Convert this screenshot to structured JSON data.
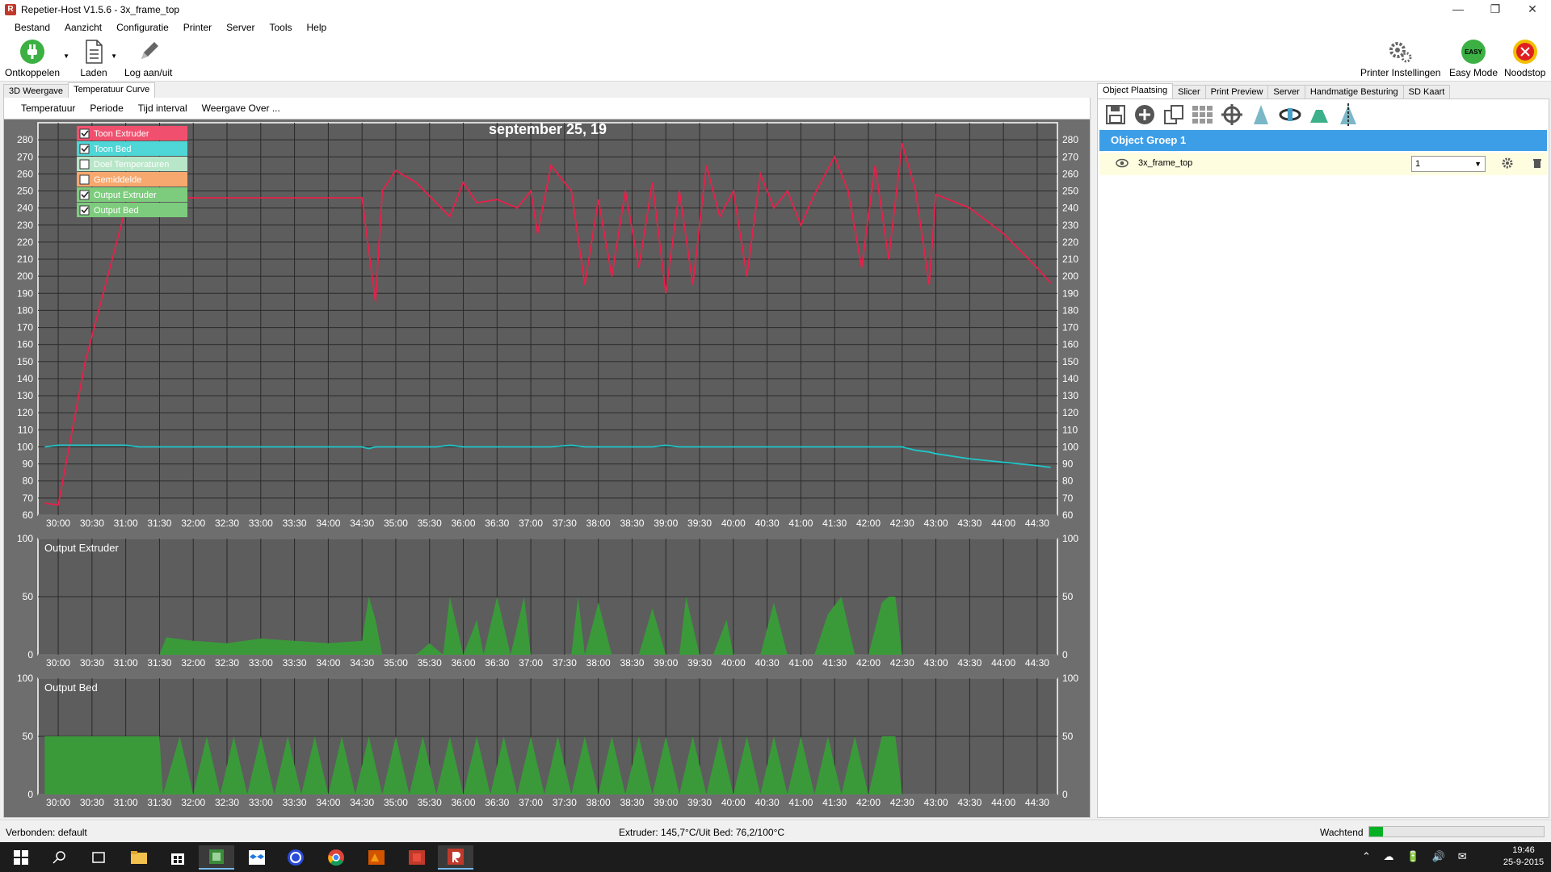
{
  "window": {
    "title": "Repetier-Host V1.5.6 - 3x_frame_top",
    "app_icon": "R"
  },
  "menu": [
    "Bestand",
    "Aanzicht",
    "Configuratie",
    "Printer",
    "Server",
    "Tools",
    "Help"
  ],
  "toolbar": {
    "connect": "Ontkoppelen",
    "load": "Laden",
    "log": "Log aan/uit",
    "printer_settings": "Printer Instellingen",
    "easy_mode": "Easy Mode",
    "easy_badge": "EASY",
    "emergency": "Noodstop"
  },
  "left_tabs": [
    {
      "label": "3D Weergave",
      "active": false
    },
    {
      "label": "Temperatuur Curve",
      "active": true
    }
  ],
  "chart_menu": [
    "Temperatuur",
    "Periode",
    "Tijd interval",
    "Weergave Over ..."
  ],
  "legend": [
    {
      "label": "Toon Extruder",
      "checked": true,
      "color": "#f0506e"
    },
    {
      "label": "Toon Bed",
      "checked": true,
      "color": "#4fd6d6"
    },
    {
      "label": "Doel Temperaturen",
      "checked": false,
      "color": "#b8e6c8"
    },
    {
      "label": "Gemiddelde",
      "checked": false,
      "color": "#f7a86e"
    },
    {
      "label": "Output Extruder",
      "checked": true,
      "color": "#7dcc7d"
    },
    {
      "label": "Output Bed",
      "checked": true,
      "color": "#7dcc7d"
    }
  ],
  "chart_data": [
    {
      "type": "line",
      "title": "september 25, 19",
      "ylim": [
        60,
        290
      ],
      "yticks": [
        60,
        70,
        80,
        90,
        100,
        110,
        120,
        130,
        140,
        150,
        160,
        170,
        180,
        190,
        200,
        210,
        220,
        230,
        240,
        250,
        260,
        270,
        280
      ],
      "xticks": [
        "30:00",
        "30:30",
        "31:00",
        "31:30",
        "32:00",
        "32:30",
        "33:00",
        "33:30",
        "34:00",
        "34:30",
        "35:00",
        "35:30",
        "36:00",
        "36:30",
        "37:00",
        "37:30",
        "38:00",
        "38:30",
        "39:00",
        "39:30",
        "40:00",
        "40:30",
        "41:00",
        "41:30",
        "42:00",
        "42:30",
        "43:00",
        "43:30",
        "44:00",
        "44:30"
      ],
      "x_minutes": [
        29.8,
        30.0,
        30.4,
        30.8,
        31.0,
        31.2,
        31.5,
        34.5,
        34.6,
        34.7,
        34.8,
        35.0,
        35.3,
        35.6,
        35.8,
        36.0,
        36.2,
        36.5,
        36.8,
        37.0,
        37.1,
        37.3,
        37.6,
        37.8,
        38.0,
        38.2,
        38.4,
        38.6,
        38.8,
        39.0,
        39.2,
        39.4,
        39.6,
        39.8,
        40.0,
        40.2,
        40.4,
        40.6,
        40.8,
        41.0,
        41.2,
        41.5,
        41.7,
        41.9,
        42.1,
        42.3,
        42.5,
        42.7,
        42.9,
        43.0,
        43.5,
        44.0,
        44.5,
        44.7
      ],
      "series": [
        {
          "name": "Toon Extruder",
          "color": "#e8204a",
          "values": [
            67,
            66,
            150,
            210,
            240,
            246,
            246,
            246,
            215,
            185,
            250,
            262,
            255,
            243,
            235,
            255,
            243,
            245,
            240,
            250,
            225,
            265,
            250,
            195,
            245,
            200,
            250,
            205,
            255,
            190,
            250,
            195,
            265,
            235,
            250,
            200,
            260,
            240,
            250,
            230,
            248,
            270,
            250,
            205,
            265,
            210,
            278,
            250,
            195,
            248,
            240,
            225,
            205,
            196
          ]
        },
        {
          "name": "Toon Bed",
          "color": "#1fc6c9",
          "values": [
            100,
            101,
            101,
            101,
            101,
            100,
            100,
            100,
            99,
            100,
            100,
            100,
            100,
            100,
            101,
            100,
            100,
            100,
            100,
            100,
            100,
            100,
            101,
            100,
            100,
            100,
            100,
            100,
            100,
            101,
            100,
            100,
            100,
            100,
            100,
            100,
            100,
            100,
            100,
            100,
            100,
            100,
            100,
            100,
            100,
            100,
            100,
            98,
            97,
            96,
            93,
            91,
            89,
            88
          ]
        }
      ]
    },
    {
      "type": "area",
      "title": "Output Extruder",
      "ylim": [
        0,
        100
      ],
      "yticks": [
        0,
        50,
        100
      ],
      "xticks": [
        "30:00",
        "30:30",
        "31:00",
        "31:30",
        "32:00",
        "32:30",
        "33:00",
        "33:30",
        "34:00",
        "34:30",
        "35:00",
        "35:30",
        "36:00",
        "36:30",
        "37:00",
        "37:30",
        "38:00",
        "38:30",
        "39:00",
        "39:30",
        "40:00",
        "40:30",
        "41:00",
        "41:30",
        "42:00",
        "42:30",
        "43:00",
        "43:30",
        "44:00",
        "44:30"
      ],
      "series": [
        {
          "name": "Output Extruder",
          "color": "#3a9a3a",
          "x_minutes": [
            31.5,
            31.6,
            32.0,
            32.5,
            33.0,
            33.5,
            34.0,
            34.5,
            34.6,
            34.7,
            34.8,
            35.3,
            35.5,
            35.7,
            35.8,
            36.0,
            36.2,
            36.3,
            36.5,
            36.7,
            36.9,
            37.0,
            37.1,
            37.3,
            37.6,
            37.7,
            37.8,
            38.0,
            38.2,
            38.4,
            38.6,
            38.8,
            39.0,
            39.2,
            39.3,
            39.5,
            39.7,
            39.9,
            40.0,
            40.2,
            40.4,
            40.6,
            40.8,
            41.0,
            41.2,
            41.4,
            41.6,
            41.8,
            42.0,
            42.2,
            42.3,
            42.4,
            42.5
          ],
          "values": [
            0,
            15,
            12,
            10,
            14,
            12,
            10,
            12,
            50,
            30,
            0,
            0,
            10,
            0,
            50,
            0,
            30,
            0,
            50,
            0,
            50,
            0,
            0,
            0,
            0,
            50,
            0,
            45,
            0,
            0,
            0,
            40,
            0,
            0,
            50,
            0,
            0,
            30,
            0,
            0,
            0,
            45,
            0,
            0,
            0,
            35,
            50,
            0,
            0,
            45,
            50,
            50,
            0
          ]
        }
      ]
    },
    {
      "type": "area",
      "title": "Output Bed",
      "ylim": [
        0,
        100
      ],
      "yticks": [
        0,
        50,
        100
      ],
      "xticks": [
        "30:00",
        "30:30",
        "31:00",
        "31:30",
        "32:00",
        "32:30",
        "33:00",
        "33:30",
        "34:00",
        "34:30",
        "35:00",
        "35:30",
        "36:00",
        "36:30",
        "37:00",
        "37:30",
        "38:00",
        "38:30",
        "39:00",
        "39:30",
        "40:00",
        "40:30",
        "41:00",
        "41:30",
        "42:00",
        "42:30",
        "43:00",
        "43:30",
        "44:00",
        "44:30"
      ],
      "series": [
        {
          "name": "Output Bed",
          "color": "#3a9a3a",
          "x_minutes": [
            29.8,
            31.5,
            31.55,
            31.8,
            32.0,
            32.2,
            32.4,
            32.6,
            32.8,
            33.0,
            33.2,
            33.4,
            33.6,
            33.8,
            34.0,
            34.2,
            34.4,
            34.6,
            34.8,
            35.0,
            35.2,
            35.4,
            35.6,
            35.8,
            36.0,
            36.2,
            36.4,
            36.6,
            36.8,
            37.0,
            37.2,
            37.4,
            37.6,
            37.8,
            38.0,
            38.2,
            38.4,
            38.6,
            38.8,
            39.0,
            39.2,
            39.4,
            39.6,
            39.8,
            40.0,
            40.2,
            40.4,
            40.6,
            40.8,
            41.0,
            41.2,
            41.4,
            41.6,
            41.8,
            42.0,
            42.2,
            42.4,
            42.5
          ],
          "values": [
            50,
            50,
            0,
            50,
            0,
            50,
            0,
            50,
            0,
            50,
            0,
            50,
            0,
            50,
            0,
            50,
            0,
            50,
            0,
            50,
            0,
            50,
            0,
            50,
            0,
            50,
            0,
            50,
            0,
            50,
            0,
            50,
            0,
            50,
            0,
            50,
            0,
            50,
            0,
            50,
            0,
            50,
            0,
            50,
            0,
            50,
            0,
            50,
            0,
            50,
            0,
            50,
            0,
            50,
            0,
            50,
            50,
            0
          ]
        }
      ]
    }
  ],
  "right_tabs": [
    {
      "label": "Object Plaatsing",
      "active": true
    },
    {
      "label": "Slicer",
      "active": false
    },
    {
      "label": "Print Preview",
      "active": false
    },
    {
      "label": "Server",
      "active": false
    },
    {
      "label": "Handmatige Besturing",
      "active": false
    },
    {
      "label": "SD Kaart",
      "active": false
    }
  ],
  "right_panel": {
    "group": "Object Groep 1",
    "object_name": "3x_frame_top",
    "copies": "1"
  },
  "status": {
    "connection": "Verbonden: default",
    "temps": "Extruder: 145,7°C/Uit Bed: 76,2/100°C",
    "state": "Wachtend",
    "progress": 0.08
  },
  "taskbar": {
    "time": "19:46",
    "date": "25-9-2015"
  }
}
